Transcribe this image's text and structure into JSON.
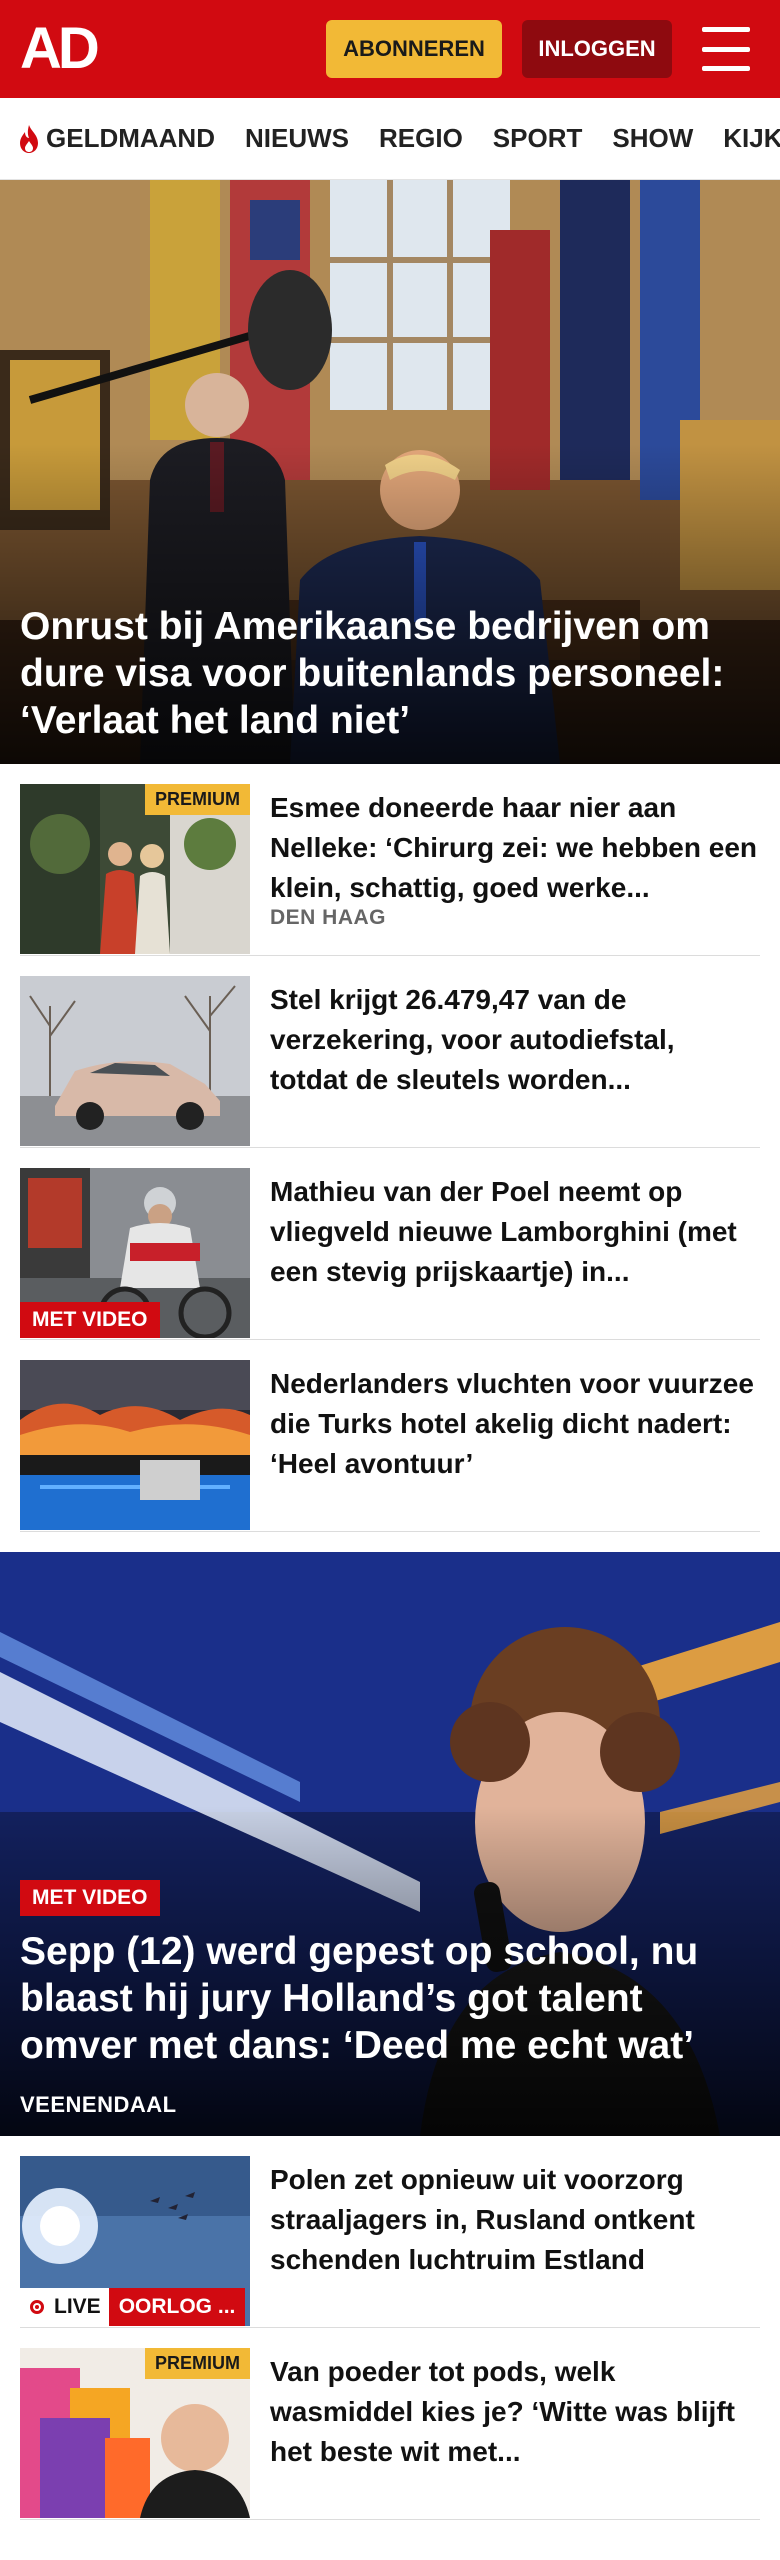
{
  "header": {
    "logo": "AD",
    "subscribe_label": "ABONNEREN",
    "login_label": "INLOGGEN",
    "colors": {
      "brand": "#d10a11",
      "subscribe": "#f2b936",
      "login": "#8e0a0f"
    }
  },
  "nav": {
    "items": [
      {
        "label": "GELDMAAND",
        "icon": "flame-icon"
      },
      {
        "label": "NIEUWS"
      },
      {
        "label": "REGIO"
      },
      {
        "label": "SPORT"
      },
      {
        "label": "SHOW"
      },
      {
        "label": "KIJK"
      }
    ]
  },
  "hero": {
    "title": "Onrust bij Amerikaanse bedrijven om dure visa voor buitenlands personeel: ‘Verlaat het land niet’"
  },
  "articles": [
    {
      "title": "Esmee doneerde haar nier aan Nelleke: ‘Chirurg zei: we hebben een klein, schattig, goed werke...",
      "location": "DEN HAAG",
      "badge": "PREMIUM"
    },
    {
      "title": "Stel krijgt 26.479,47 van de verzekering, voor autodiefstal, totdat de sleutels worden..."
    },
    {
      "title": "Mathieu van der Poel neemt op vliegveld nieuwe Lamborghini (met een stevig prijskaartje) in...",
      "badge": "MET VIDEO"
    },
    {
      "title": "Nederlanders vluchten voor vuurzee die Turks hotel akelig dicht nadert: ‘Heel avontuur’"
    }
  ],
  "feature": {
    "badge": "MET VIDEO",
    "title": "Sepp (12) werd gepest op school, nu blaast hij jury Holland’s got talent omver met dans: ‘Deed me echt wat’",
    "location": "VEENENDAAL"
  },
  "articles2": [
    {
      "title": "Polen zet opnieuw uit voorzorg straaljagers in, Rusland ontkent schenden luchtruim Estland",
      "live_label": "LIVE",
      "tag": "OORLOG ..."
    },
    {
      "title": "Van poeder tot pods, welk wasmiddel kies je? ‘Witte was blijft het beste wit met...",
      "badge": "PREMIUM"
    }
  ]
}
